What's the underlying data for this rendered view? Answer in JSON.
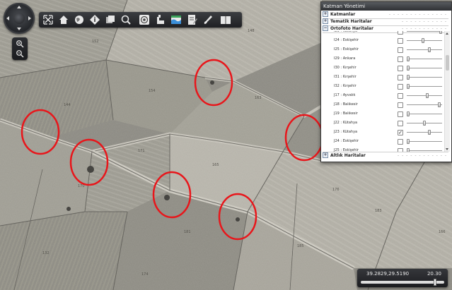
{
  "map": {
    "basemap": "aerial-orthophoto",
    "highlight_color": "#e8161b",
    "highlight_count": 7,
    "parcel_numbers": [
      "152",
      "148",
      "154",
      "163",
      "144",
      "171",
      "165",
      "170",
      "198",
      "183",
      "181",
      "185",
      "132",
      "166",
      "176",
      "174"
    ]
  },
  "navigation": {
    "pad_icon": "pan-compass-icon",
    "zoom_in_icon": "magnifier-plus-icon",
    "zoom_out_icon": "magnifier-minus-icon"
  },
  "toolbar": {
    "tools": [
      {
        "icon": "full-extent-icon"
      },
      {
        "icon": "home-icon"
      },
      {
        "icon": "globe-icon"
      },
      {
        "icon": "info-icon"
      },
      {
        "icon": "layers-icon"
      },
      {
        "icon": "search-icon"
      },
      {
        "icon": "target-icon"
      },
      {
        "icon": "measure-icon"
      },
      {
        "icon": "map-overlay-icon"
      },
      {
        "icon": "document-edit-icon"
      },
      {
        "icon": "brush-icon"
      },
      {
        "icon": "book-icon"
      }
    ]
  },
  "layer_panel": {
    "title": "Katman Yönetimi",
    "groups": [
      {
        "label": "Katmanlar",
        "expander": "+"
      },
      {
        "label": "Tematik Haritalar",
        "expander": "+"
      },
      {
        "label": "Ortofoto Haritalar",
        "expander": "−"
      }
    ],
    "rows": [
      {
        "label": "I23 : Kütahya",
        "checked": false,
        "opacity": 1.0
      },
      {
        "label": "I24 : Eskişehir",
        "checked": false,
        "opacity": 0.45
      },
      {
        "label": "I25 : Eskişehir",
        "checked": false,
        "opacity": 0.65
      },
      {
        "label": "I29 : Ankara",
        "checked": false,
        "opacity": 0.0
      },
      {
        "label": "I30 : Kırşehir",
        "checked": false,
        "opacity": 0.0
      },
      {
        "label": "I31 : Kırşehir",
        "checked": false,
        "opacity": 0.0
      },
      {
        "label": "I32 : Kırşehir",
        "checked": false,
        "opacity": 0.0
      },
      {
        "label": "J17 : Ayvalık",
        "checked": false,
        "opacity": 0.58
      },
      {
        "label": "J18 : Balıkesir",
        "checked": false,
        "opacity": 0.95
      },
      {
        "label": "J19 : Balıkesir",
        "checked": false,
        "opacity": 0.0
      },
      {
        "label": "J22 : Kütahya",
        "checked": false,
        "opacity": 0.5
      },
      {
        "label": "J23 : Kütahya",
        "checked": true,
        "opacity": 0.65
      },
      {
        "label": "J24 : Eskişehir",
        "checked": false,
        "opacity": 0.0
      },
      {
        "label": "J25 : Eskişehir",
        "checked": false,
        "opacity": 0.0
      }
    ],
    "footer_group": {
      "label": "Altlık Haritalar",
      "expander": "+"
    }
  },
  "status": {
    "coordinates": "39.2829,29.5190",
    "zoom_level": "20.30",
    "zoom_fraction": 0.92
  }
}
